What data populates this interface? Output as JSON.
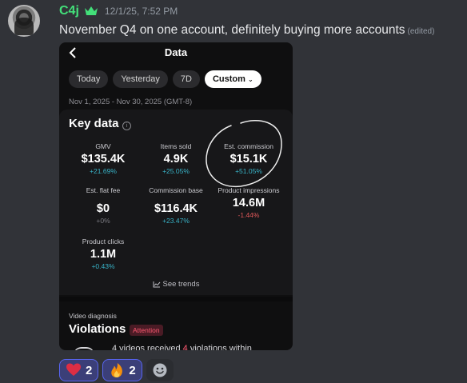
{
  "author": {
    "name": "C4j",
    "timestamp": "12/1/25, 7:52 PM",
    "badge_icon": "crown-icon"
  },
  "message": {
    "text": "November Q4 on one account, definitely buying more accounts",
    "edited_label": "(edited)"
  },
  "screenshot": {
    "title": "Data",
    "back_icon": "chevron-left-icon",
    "tabs": [
      {
        "label": "Today"
      },
      {
        "label": "Yesterday"
      },
      {
        "label": "7D"
      },
      {
        "label": "Custom",
        "active": true
      }
    ],
    "date_range": "Nov 1, 2025 - Nov 30, 2025 (GMT-8)",
    "key_data": {
      "title": "Key data",
      "metrics": [
        {
          "label": "GMV",
          "value": "$135.4K",
          "change": "+21.69%"
        },
        {
          "label": "Items sold",
          "value": "4.9K",
          "change": "+25.05%"
        },
        {
          "label": "Est. commission",
          "value": "$15.1K",
          "change": "+51.05%"
        },
        {
          "label": "Est. flat fee",
          "value": "$0",
          "change": "+0%"
        },
        {
          "label": "Commission base",
          "value": "$116.4K",
          "change": "+23.47%"
        },
        {
          "label": "Product impressions",
          "value": "14.6M",
          "change": "-1.44%"
        },
        {
          "label": "Product clicks",
          "value": "1.1M",
          "change": "+0.43%"
        }
      ],
      "see_trends": "See trends"
    },
    "video_diagnosis": {
      "label": "Video diagnosis",
      "title": "Violations",
      "badge": "Attention",
      "text_prefix": "4 videos received ",
      "text_highlight": "4",
      "text_suffix": " violations within"
    }
  },
  "reactions": [
    {
      "emoji": "heart",
      "count": "2"
    },
    {
      "emoji": "fire",
      "count": "2"
    }
  ],
  "colors": {
    "username": "#43e07a",
    "positive": "#38b3c7",
    "negative": "#e0585a",
    "reaction_bg": "#3b3f78",
    "reaction_border": "#5865f2"
  }
}
